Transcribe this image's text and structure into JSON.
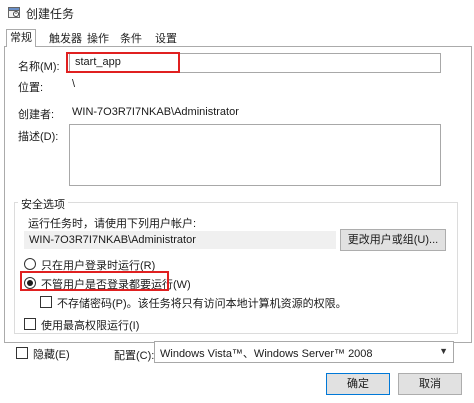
{
  "window": {
    "title": "创建任务"
  },
  "tabs": [
    {
      "label": "常规",
      "active": true
    },
    {
      "label": "触发器"
    },
    {
      "label": "操作"
    },
    {
      "label": "条件"
    },
    {
      "label": "设置"
    }
  ],
  "general": {
    "name_label": "名称(M):",
    "name_value": "start_app",
    "location_label": "位置:",
    "location_value": "\\",
    "author_label": "创建者:",
    "author_value": "WIN-7O3R7I7NKAB\\Administrator",
    "description_label": "描述(D):",
    "description_value": ""
  },
  "security": {
    "group_title": "安全选项",
    "run_as_prompt": "运行任务时，请使用下列用户帐户:",
    "account_value": "WIN-7O3R7I7NKAB\\Administrator",
    "change_button": "更改用户或组(U)...",
    "radio_logged_on": "只在用户登录时运行(R)",
    "radio_whether": "不管用户是否登录都要运行(W)",
    "radio_selected": "whether",
    "no_store_password": "不存储密码(P)。该任务将只有访问本地计算机资源的权限。",
    "highest_privileges": "使用最高权限运行(I)"
  },
  "footer": {
    "hidden_label": "隐藏(E)",
    "configure_label": "配置(C):",
    "configure_value": "Windows Vista™、Windows Server™ 2008",
    "ok_button": "确定",
    "cancel_button": "取消"
  },
  "colors": {
    "highlight": "#e02020",
    "primary_border": "#0078d7"
  }
}
